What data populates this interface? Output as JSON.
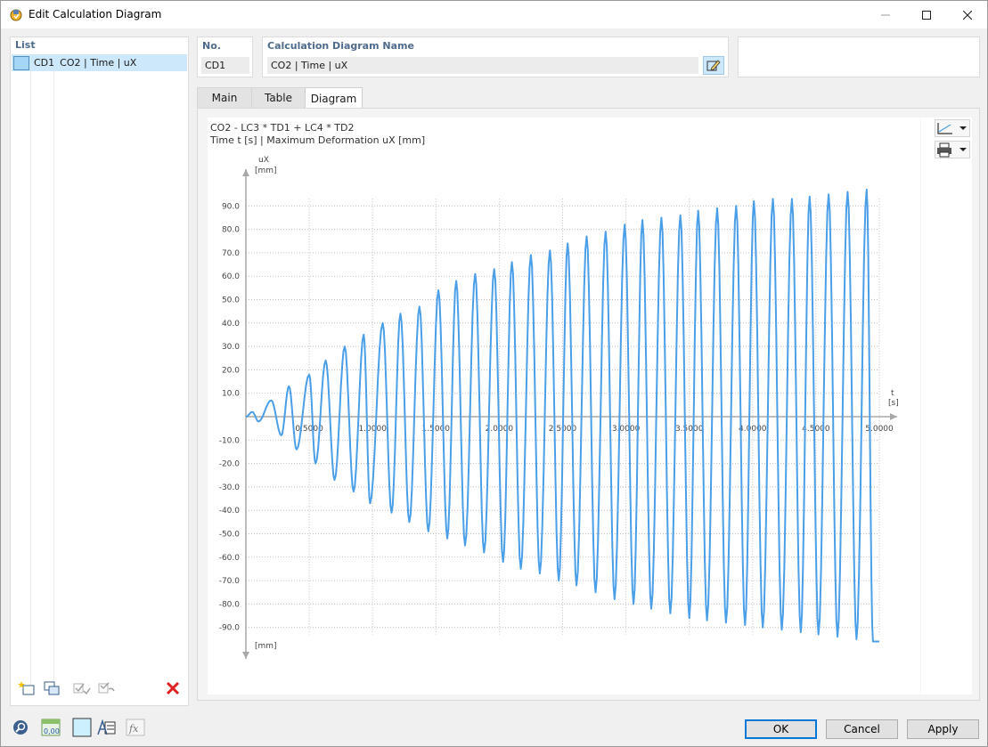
{
  "window": {
    "title": "Edit Calculation Diagram"
  },
  "list": {
    "caption": "List",
    "items": [
      {
        "id": "CD1",
        "name": "CO2 | Time | uX",
        "color": "#a6d6f7"
      }
    ]
  },
  "header": {
    "no_caption": "No.",
    "no_value": "CD1",
    "name_caption": "Calculation Diagram Name",
    "name_value": "CO2 | Time | uX"
  },
  "tabs": [
    {
      "label": "Main"
    },
    {
      "label": "Table"
    },
    {
      "label": "Diagram",
      "active": true
    }
  ],
  "diagram": {
    "title": "CO2 - LC3 * TD1 + LC4 * TD2",
    "subtitle": "Time t [s] | Maximum Deformation uX [mm]"
  },
  "buttons": {
    "ok": "OK",
    "cancel": "Cancel",
    "apply": "Apply"
  },
  "chart_data": {
    "type": "line",
    "ylabel": "uX",
    "yunit_top": "[mm]",
    "yunit_bottom": "[mm]",
    "xlabel": "t",
    "xunit": "[s]",
    "xlim": [
      0,
      5.0
    ],
    "ylim": [
      -95,
      95
    ],
    "xticks": [
      "0.5000",
      "1.0000",
      "1.5000",
      "2.0000",
      "2.5000",
      "3.0000",
      "3.5000",
      "4.0000",
      "4.5000",
      "5.0000"
    ],
    "yticks": [
      "90.0",
      "80.0",
      "70.0",
      "60.0",
      "50.0",
      "40.0",
      "30.0",
      "20.0",
      "10.0",
      "-10.0",
      "-20.0",
      "-30.0",
      "-40.0",
      "-50.0",
      "-60.0",
      "-70.0",
      "-80.0",
      "-90.0"
    ],
    "line_color": "#4a9fe8",
    "grid": true,
    "series": [
      {
        "peaks": [
          [
            0.05,
            2
          ],
          [
            0.1,
            -2
          ],
          [
            0.2,
            7
          ],
          [
            0.28,
            -8
          ],
          [
            0.34,
            13
          ],
          [
            0.4,
            -14
          ],
          [
            0.5,
            18
          ],
          [
            0.55,
            -20
          ],
          [
            0.63,
            24
          ],
          [
            0.7,
            -27
          ],
          [
            0.78,
            30
          ],
          [
            0.85,
            -32
          ],
          [
            0.93,
            35
          ],
          [
            0.98,
            -37
          ],
          [
            1.08,
            40
          ],
          [
            1.15,
            -41
          ],
          [
            1.22,
            44
          ],
          [
            1.29,
            -45
          ],
          [
            1.37,
            47
          ],
          [
            1.44,
            -49
          ],
          [
            1.52,
            54
          ],
          [
            1.59,
            -52
          ],
          [
            1.66,
            58
          ],
          [
            1.73,
            -55
          ],
          [
            1.81,
            61
          ],
          [
            1.88,
            -58
          ],
          [
            1.96,
            63
          ],
          [
            2.03,
            -62
          ],
          [
            2.1,
            66
          ],
          [
            2.17,
            -65
          ],
          [
            2.25,
            69
          ],
          [
            2.32,
            -67
          ],
          [
            2.4,
            71
          ],
          [
            2.47,
            -70
          ],
          [
            2.54,
            74
          ],
          [
            2.61,
            -72
          ],
          [
            2.69,
            77
          ],
          [
            2.76,
            -75
          ],
          [
            2.84,
            79
          ],
          [
            2.91,
            -78
          ],
          [
            2.99,
            82
          ],
          [
            3.06,
            -80
          ],
          [
            3.13,
            84
          ],
          [
            3.2,
            -82
          ],
          [
            3.28,
            85
          ],
          [
            3.35,
            -84
          ],
          [
            3.43,
            86
          ],
          [
            3.5,
            -86
          ],
          [
            3.57,
            88
          ],
          [
            3.64,
            -87
          ],
          [
            3.72,
            89
          ],
          [
            3.79,
            -88
          ],
          [
            3.87,
            90
          ],
          [
            3.94,
            -89
          ],
          [
            4.01,
            92
          ],
          [
            4.08,
            -90
          ],
          [
            4.16,
            93
          ],
          [
            4.23,
            -91
          ],
          [
            4.31,
            93
          ],
          [
            4.38,
            -92
          ],
          [
            4.45,
            94
          ],
          [
            4.52,
            -93
          ],
          [
            4.6,
            95
          ],
          [
            4.67,
            -94
          ],
          [
            4.75,
            96
          ],
          [
            4.82,
            -95
          ],
          [
            4.9,
            97
          ],
          [
            4.95,
            -96
          ],
          [
            5.0,
            -96
          ]
        ]
      }
    ]
  }
}
